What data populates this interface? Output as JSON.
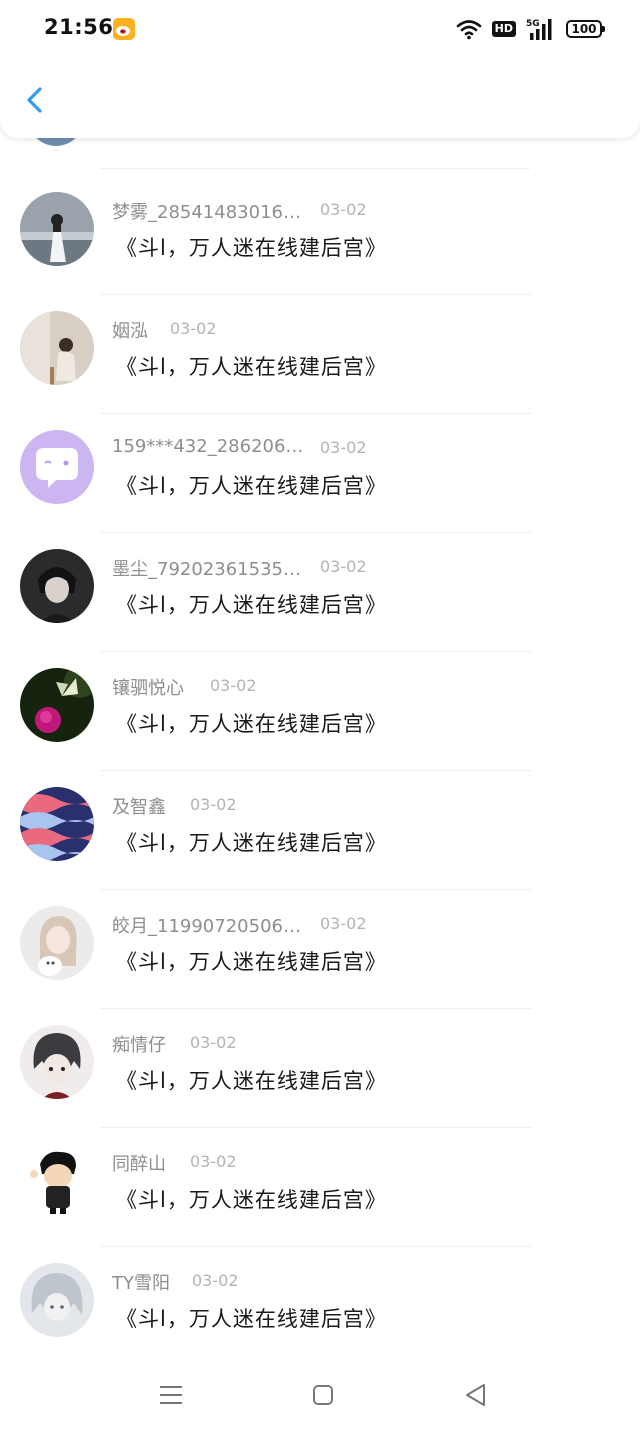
{
  "status_bar": {
    "time": "21:56",
    "hd": "HD",
    "network": "5G",
    "battery": "100"
  },
  "header": {
    "back_icon": "chevron-left-icon",
    "accent_color": "#2f9bf2"
  },
  "comments": [
    {
      "username": "梦雾_28541483016…",
      "date": "03-02",
      "text": "《斗l，万人迷在线建后宫》",
      "avatar": "girl-in-white-dress"
    },
    {
      "username": "姻泓",
      "date": "03-02",
      "text": "《斗l，万人迷在线建后宫》",
      "avatar": "girl-sitting"
    },
    {
      "username": "159***432_286206…",
      "date": "03-02",
      "text": "《斗l，万人迷在线建后宫》",
      "avatar": "purple-chat-bubble"
    },
    {
      "username": "墨尘_79202361535…",
      "date": "03-02",
      "text": "《斗l，万人迷在线建后宫》",
      "avatar": "dark-anime-boy"
    },
    {
      "username": "镶驷悦心",
      "date": "03-02",
      "text": "《斗l，万人迷在线建后宫》",
      "avatar": "butterfly-on-flower"
    },
    {
      "username": "及智鑫",
      "date": "03-02",
      "text": "《斗l，万人迷在线建后宫》",
      "avatar": "wave-pattern"
    },
    {
      "username": "皎月_11990720506…",
      "date": "03-02",
      "text": "《斗l，万人迷在线建后宫》",
      "avatar": "girl-with-cat"
    },
    {
      "username": "痴情仔",
      "date": "03-02",
      "text": "《斗l，万人迷在线建后宫》",
      "avatar": "anime-girl-sketch"
    },
    {
      "username": "同醉山",
      "date": "03-02",
      "text": "《斗l，万人迷在线建后宫》",
      "avatar": "crayon-shinchan"
    },
    {
      "username": "TY雪阳",
      "date": "03-02",
      "text": "《斗l，万人迷在线建后宫》",
      "avatar": "pale-anime-girl"
    }
  ],
  "nav_bar": {
    "menu_icon": "menu-icon",
    "home_icon": "home-square-icon",
    "back_icon": "back-triangle-icon"
  }
}
